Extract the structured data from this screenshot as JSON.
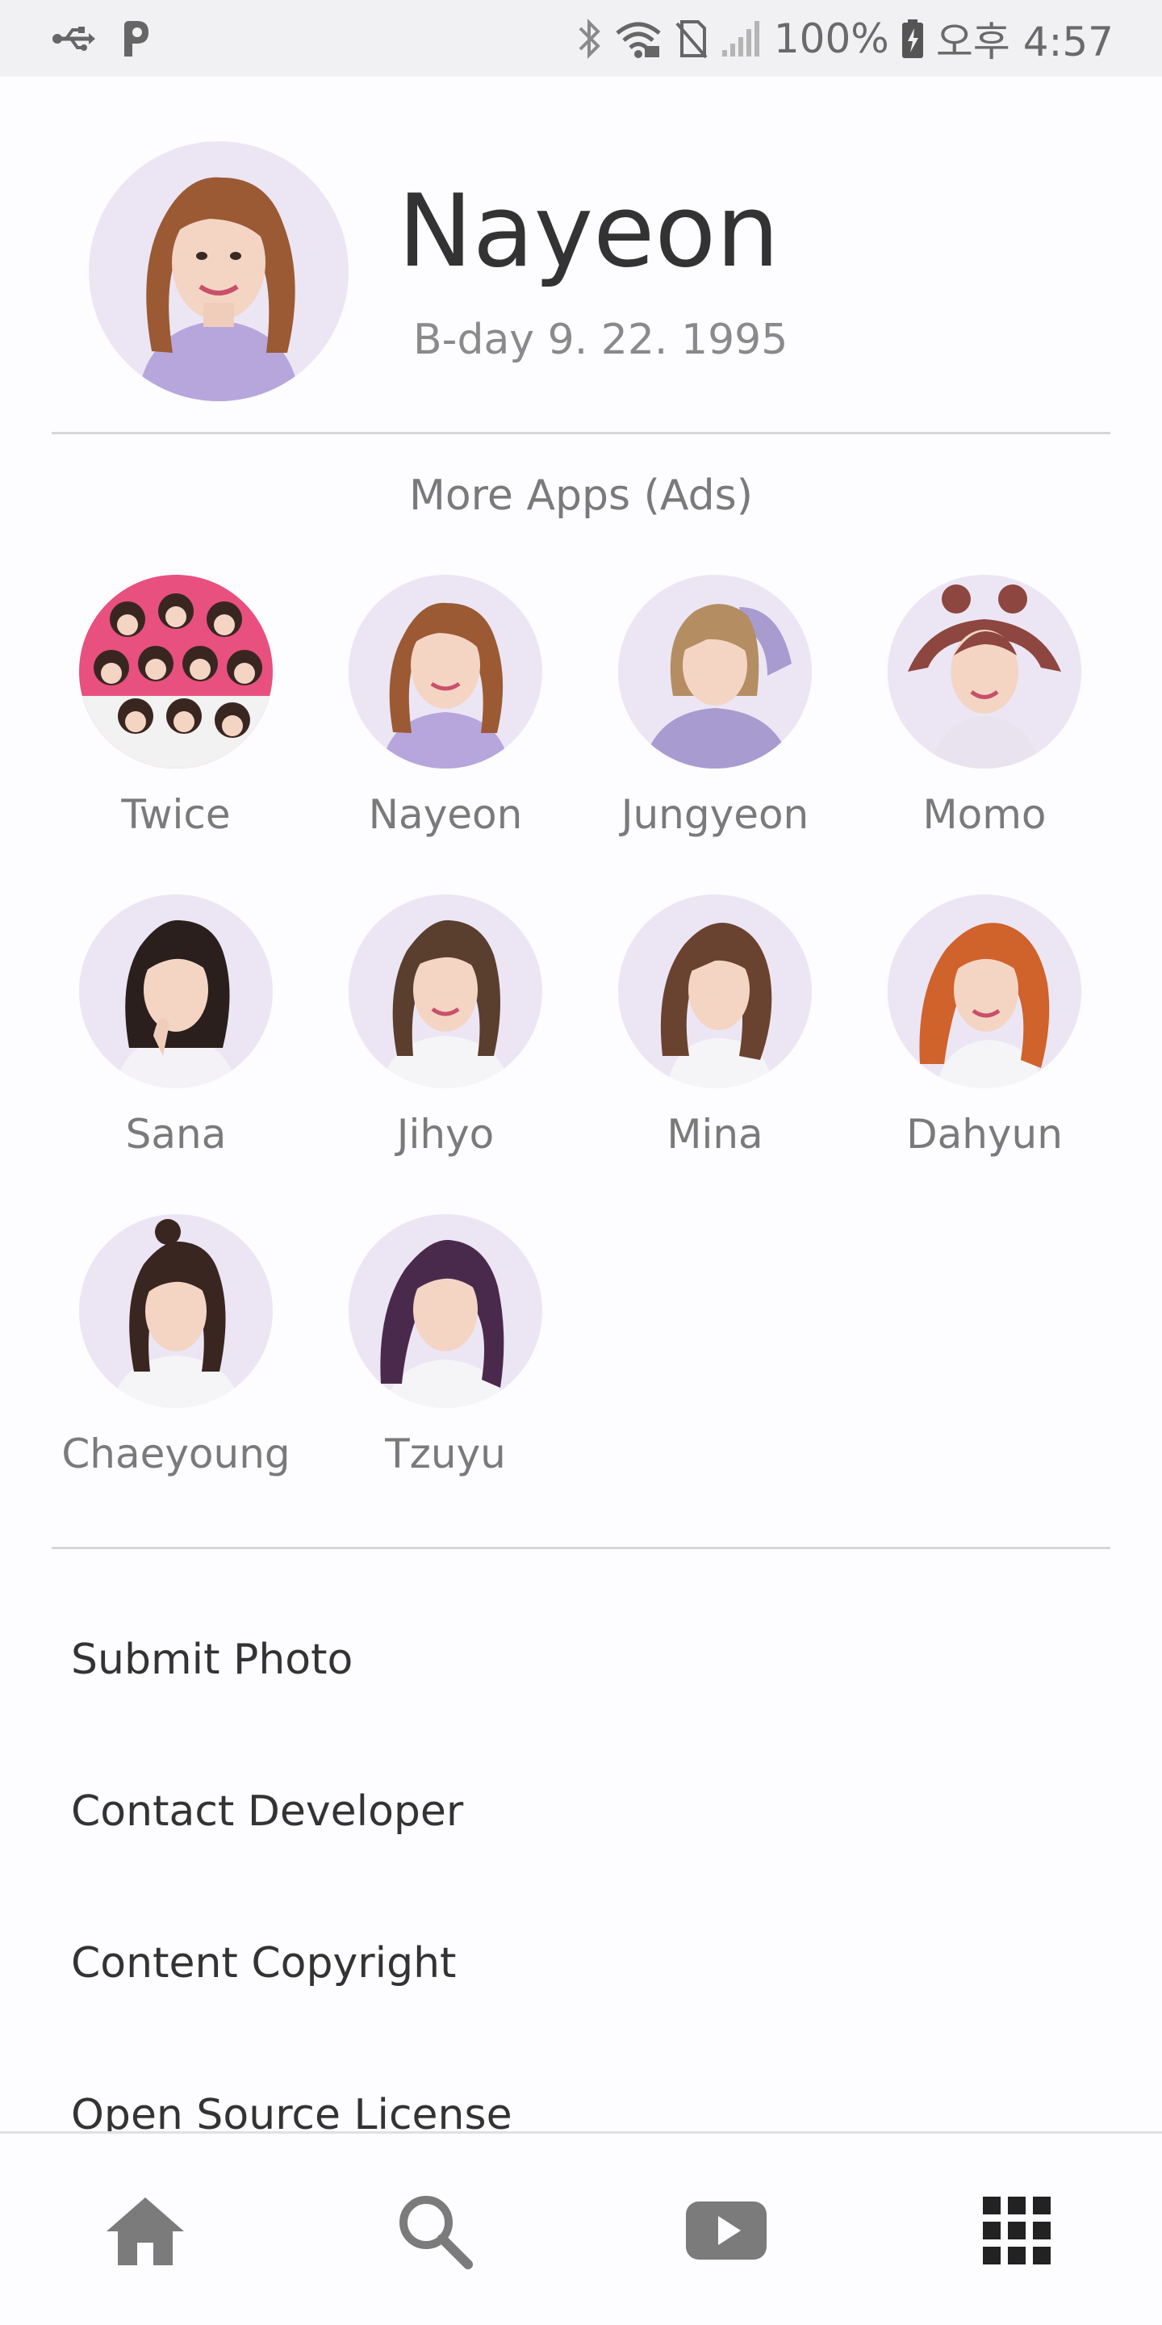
{
  "status_bar": {
    "battery": "100%",
    "time": "오후 4:57",
    "icons": [
      "usb-icon",
      "p-app-icon",
      "bluetooth-icon",
      "wifi-icon",
      "no-sim-icon",
      "signal-icon",
      "battery-charging-icon"
    ]
  },
  "profile": {
    "name": "Nayeon",
    "birthday": "B-day 9. 22. 1995"
  },
  "more_apps": {
    "title": "More Apps (Ads)",
    "apps": [
      {
        "label": "Twice"
      },
      {
        "label": "Nayeon"
      },
      {
        "label": "Jungyeon"
      },
      {
        "label": "Momo"
      },
      {
        "label": "Sana"
      },
      {
        "label": "Jihyo"
      },
      {
        "label": "Mina"
      },
      {
        "label": "Dahyun"
      },
      {
        "label": "Chaeyoung"
      },
      {
        "label": "Tzuyu"
      }
    ]
  },
  "menu": {
    "items": [
      {
        "label": "Submit Photo"
      },
      {
        "label": "Contact Developer"
      },
      {
        "label": "Content Copyright"
      },
      {
        "label": "Open Source License"
      }
    ]
  },
  "bottom_nav": {
    "items": [
      "home-icon",
      "search-icon",
      "youtube-icon",
      "grid-menu-icon"
    ]
  },
  "colors": {
    "background": "#fdfcfe",
    "status_bar": "#f1f0f2",
    "text_primary": "#333333",
    "text_secondary": "#7a7a7a",
    "icon_gray": "#7b7b7b",
    "icon_dark": "#222222"
  }
}
